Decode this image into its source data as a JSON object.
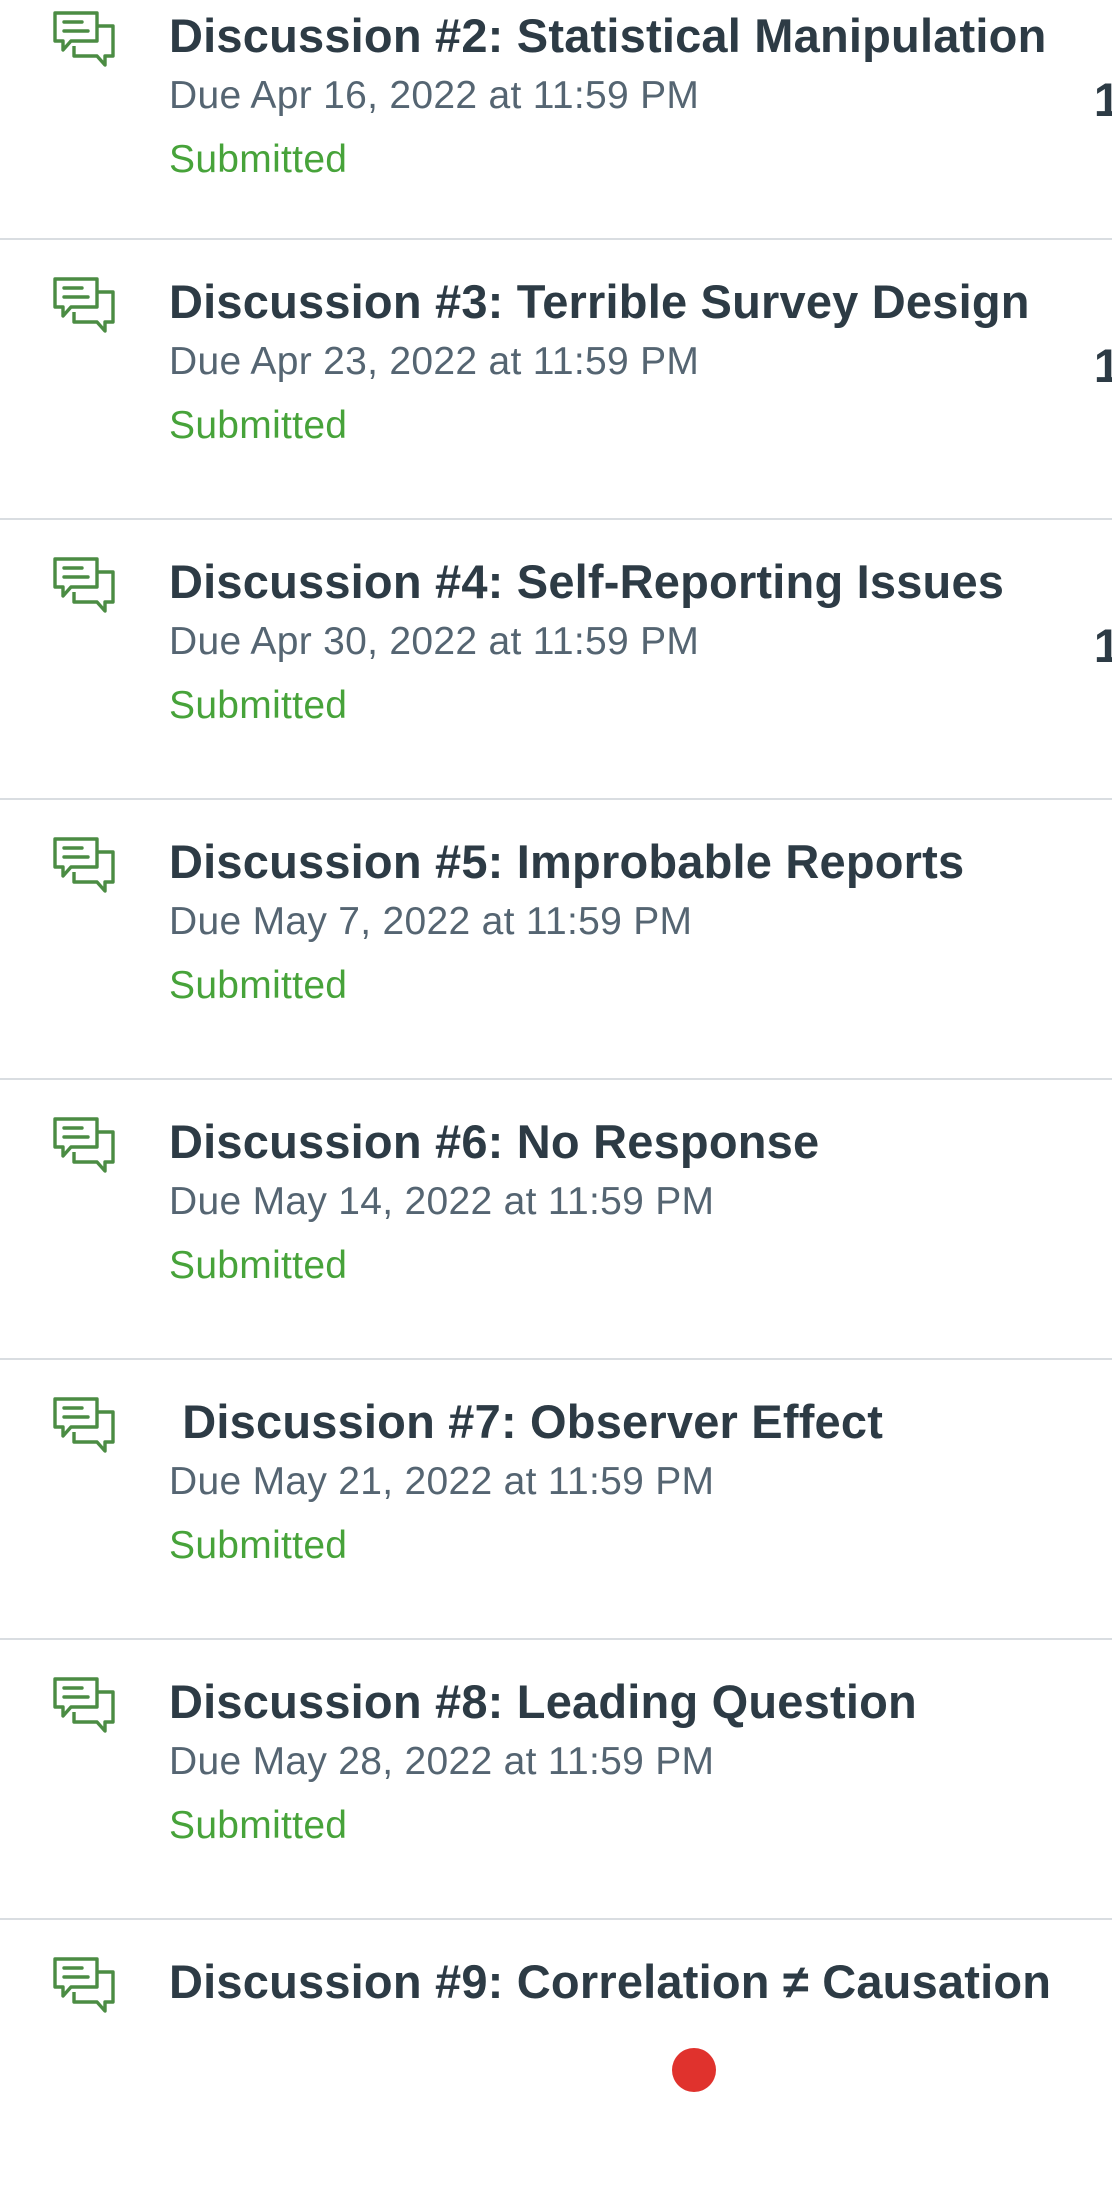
{
  "assignments": [
    {
      "title": "Discussion #2: Statistical Manipulation",
      "due": "Due Apr 16, 2022 at 11:59 PM",
      "status": "Submitted",
      "points": "1",
      "icon": "discussion-icon"
    },
    {
      "title": "Discussion #3: Terrible Survey Design",
      "due": "Due Apr 23, 2022 at 11:59 PM",
      "status": "Submitted",
      "points": "1",
      "icon": "discussion-icon"
    },
    {
      "title": "Discussion #4: Self-Reporting Issues",
      "due": "Due Apr 30, 2022 at 11:59 PM",
      "status": "Submitted",
      "points": "1",
      "icon": "discussion-icon"
    },
    {
      "title": "Discussion #5: Improbable Reports",
      "due": "Due May 7, 2022 at 11:59 PM",
      "status": "Submitted",
      "icon": "discussion-icon"
    },
    {
      "title": "Discussion #6: No Response",
      "due": "Due May 14, 2022 at 11:59 PM",
      "status": "Submitted",
      "icon": "discussion-icon"
    },
    {
      "title": " Discussion #7: Observer Effect",
      "due": "Due May 21, 2022 at 11:59 PM",
      "status": "Submitted",
      "icon": "discussion-icon"
    },
    {
      "title": "Discussion #8: Leading Question",
      "due": "Due May 28, 2022 at 11:59 PM",
      "status": "Submitted",
      "icon": "discussion-icon"
    },
    {
      "title": "Discussion #9: Correlation ≠ Causation",
      "icon": "discussion-icon"
    }
  ],
  "colors": {
    "title": "#2d3b45",
    "due": "#556572",
    "submitted": "#47a33a",
    "icon": "#4b8c43",
    "divider": "#d9dde1",
    "badge": "#e0322d"
  }
}
